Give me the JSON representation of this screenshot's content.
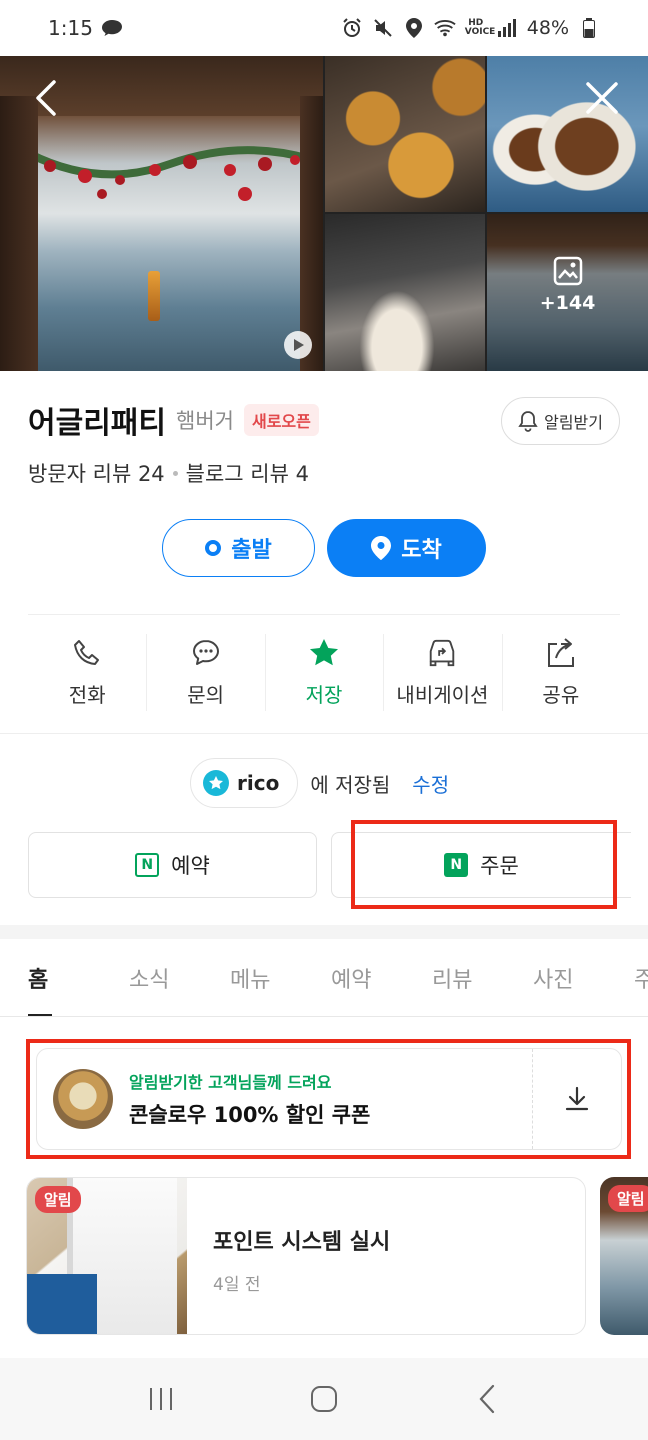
{
  "status_bar": {
    "time": "1:15",
    "battery": "48%",
    "network_label": "HD VOICE"
  },
  "gallery": {
    "more_count": "+144"
  },
  "place": {
    "name": "어글리패티",
    "category": "햄버거",
    "badge": "새로오픈",
    "notify_label": "알림받기",
    "visitor_reviews": "방문자 리뷰 24",
    "blog_reviews": "블로그 리뷰 4"
  },
  "route": {
    "start_label": "출발",
    "end_label": "도착"
  },
  "actions": [
    {
      "label": "전화",
      "icon": "phone-icon"
    },
    {
      "label": "문의",
      "icon": "chat-icon"
    },
    {
      "label": "저장",
      "icon": "star-icon"
    },
    {
      "label": "내비게이션",
      "icon": "car-navigation-icon"
    },
    {
      "label": "공유",
      "icon": "share-icon"
    }
  ],
  "saved": {
    "list_name": "rico",
    "text": "에 저장됨",
    "edit_label": "수정"
  },
  "booking": {
    "reserve_label": "예약",
    "order_label": "주문"
  },
  "tabs": [
    "홈",
    "소식",
    "메뉴",
    "예약",
    "리뷰",
    "사진",
    "주변"
  ],
  "coupon": {
    "subtitle": "알림받기한 고객님들께 드려요",
    "title": "콘슬로우 100% 할인 쿠폰"
  },
  "news": [
    {
      "badge": "알림",
      "title": "포인트 시스템 실시",
      "date": "4일 전"
    },
    {
      "badge": "알림"
    }
  ],
  "colors": {
    "accent": "#0b7ff5",
    "naver_green": "#03a35b",
    "highlight": "#ec2a18",
    "alert_red": "#e2484b"
  }
}
